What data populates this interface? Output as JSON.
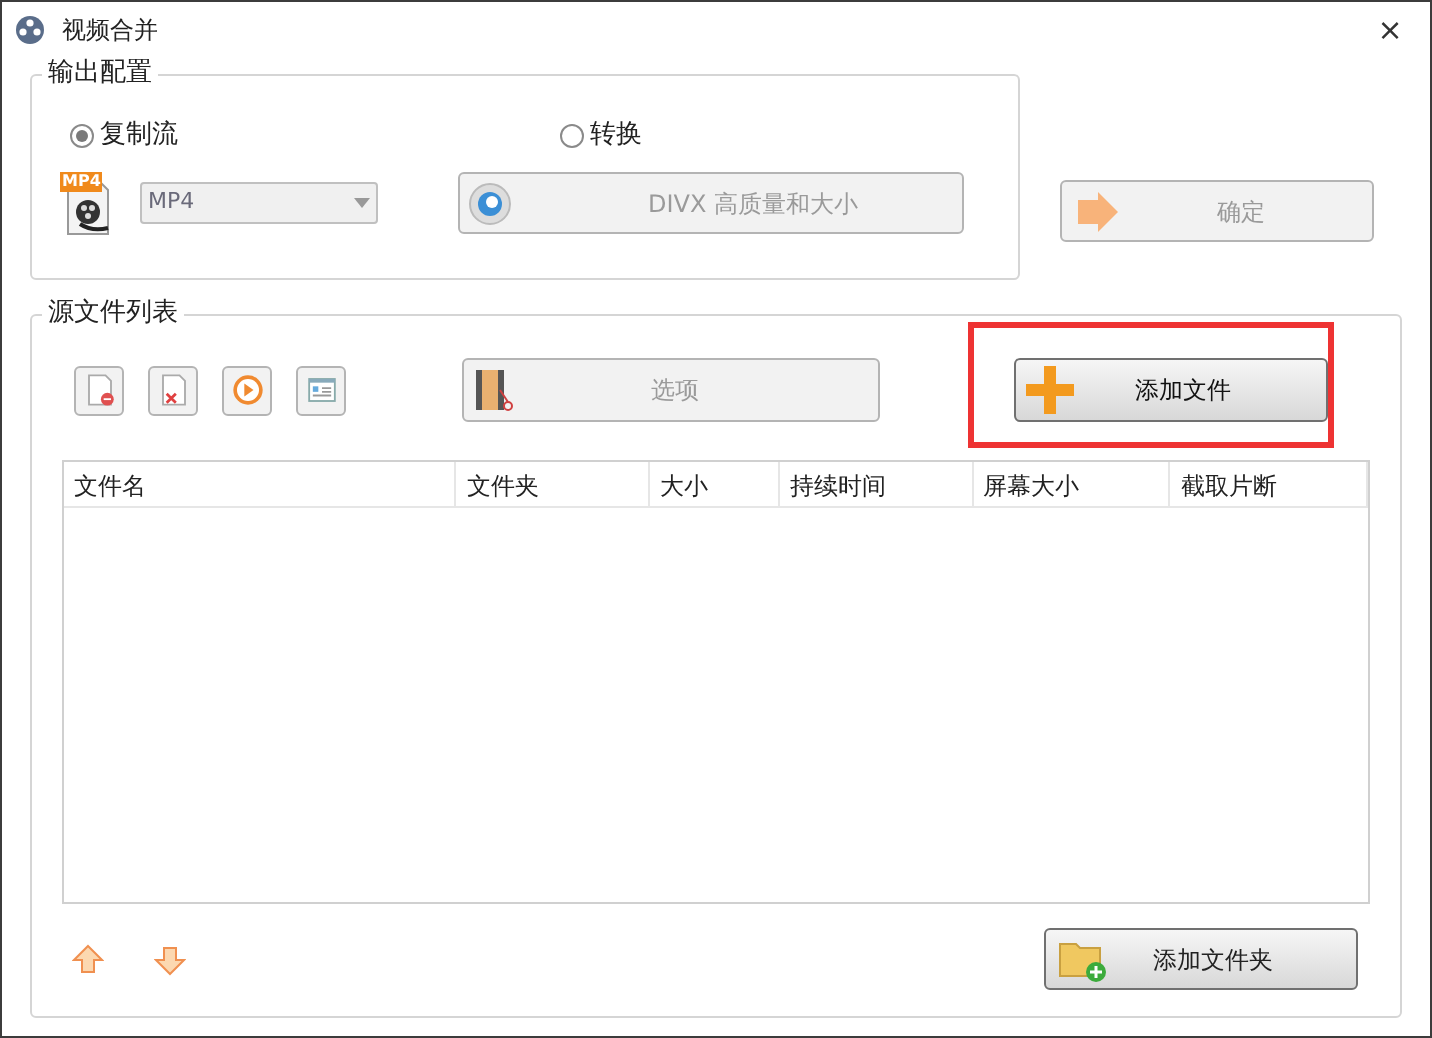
{
  "window": {
    "title": "视频合并",
    "close": "×"
  },
  "output_config": {
    "title": "输出配置",
    "modes": [
      {
        "label": "复制流",
        "selected": true
      },
      {
        "label": "转换",
        "selected": false
      }
    ],
    "format": {
      "badge": "MP4",
      "value": "MP4",
      "disabled": true
    },
    "quality_button": {
      "label": "DIVX 高质量和大小",
      "disabled": true
    },
    "confirm_button": {
      "label": "确定",
      "disabled": true
    }
  },
  "source_files": {
    "title": "源文件列表",
    "tool_buttons": [
      {
        "kind": "remove"
      },
      {
        "kind": "clear"
      },
      {
        "kind": "play"
      },
      {
        "kind": "info"
      }
    ],
    "options_button": {
      "label": "选项",
      "disabled": true
    },
    "add_file_button": {
      "label": "添加文件",
      "highlighted": true
    },
    "table": {
      "columns": [
        "文件名",
        "文件夹",
        "大小",
        "持续时间",
        "屏幕大小",
        "截取片断"
      ]
    },
    "move_buttons": [
      {
        "kind": "up"
      },
      {
        "kind": "down"
      }
    ],
    "add_folder_button": {
      "label": "添加文件夹"
    }
  }
}
